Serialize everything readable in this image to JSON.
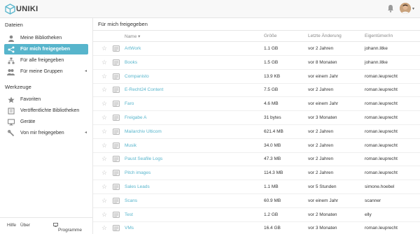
{
  "brand": {
    "name": "UNIKI"
  },
  "sidebar": {
    "section1": "Dateien",
    "files": [
      {
        "label": "Meine Bibliotheken",
        "icon": "user-icon"
      },
      {
        "label": "Für mich freigegeben",
        "icon": "share-icon",
        "active": true
      },
      {
        "label": "Für alle freigegeben",
        "icon": "network-icon"
      },
      {
        "label": "Für meine Gruppen",
        "icon": "group-icon",
        "expandable": true
      }
    ],
    "section2": "Werkzeuge",
    "tools": [
      {
        "label": "Favoriten",
        "icon": "star-icon"
      },
      {
        "label": "Veröffentlichte Bibliotheken",
        "icon": "book-icon"
      },
      {
        "label": "Geräte",
        "icon": "monitor-icon"
      },
      {
        "label": "Von mir freigegeben",
        "icon": "wrench-icon",
        "expandable": true
      }
    ],
    "footer": {
      "help": "Hilfe",
      "about": "Über",
      "programs": "Programme"
    }
  },
  "main": {
    "title": "Für mich freigegeben",
    "columns": {
      "name": "Name",
      "size": "Größe",
      "modified": "Letzte Änderung",
      "owner": "Eigentümer/in"
    },
    "rows": [
      {
        "name": "ArtWork",
        "size": "1.1 GB",
        "modified": "vor 2 Jahren",
        "owner": "johann.litke"
      },
      {
        "name": "Books",
        "size": "1.5 GB",
        "modified": "vor 8 Monaten",
        "owner": "johann.litke"
      },
      {
        "name": "Companisto",
        "size": "13.9 KB",
        "modified": "vor einem Jahr",
        "owner": "roman.leuprecht"
      },
      {
        "name": "E-Recht24 Content",
        "size": "7.5 GB",
        "modified": "vor 2 Jahren",
        "owner": "roman.leuprecht"
      },
      {
        "name": "Faro",
        "size": "4.6 MB",
        "modified": "vor einem Jahr",
        "owner": "roman.leuprecht"
      },
      {
        "name": "Freigabe A",
        "size": "31 bytes",
        "modified": "vor 3 Monaten",
        "owner": "roman.leuprecht"
      },
      {
        "name": "Mailarchiv Ulticom",
        "size": "621.4 MB",
        "modified": "vor 2 Jahren",
        "owner": "roman.leuprecht"
      },
      {
        "name": "Musik",
        "size": "34.0 MB",
        "modified": "vor 2 Jahren",
        "owner": "roman.leuprecht"
      },
      {
        "name": "Paust Seafile Logs",
        "size": "47.3 MB",
        "modified": "vor 2 Jahren",
        "owner": "roman.leuprecht"
      },
      {
        "name": "Pitch images",
        "size": "114.3 MB",
        "modified": "vor 2 Jahren",
        "owner": "roman.leuprecht"
      },
      {
        "name": "Sales Leads",
        "size": "1.1 MB",
        "modified": "vor 5 Stunden",
        "owner": "simone.hoebel"
      },
      {
        "name": "Scans",
        "size": "60.9 MB",
        "modified": "vor einem Jahr",
        "owner": "scanner"
      },
      {
        "name": "Test",
        "size": "1.2 GB",
        "modified": "vor 2 Monaten",
        "owner": "elly"
      },
      {
        "name": "VMs",
        "size": "16.4 GB",
        "modified": "vor 3 Monaten",
        "owner": "roman.leuprecht"
      }
    ]
  },
  "colors": {
    "accent": "#57b5cc",
    "topbar": "#f8f8f8",
    "logo": "#57b5cc"
  }
}
